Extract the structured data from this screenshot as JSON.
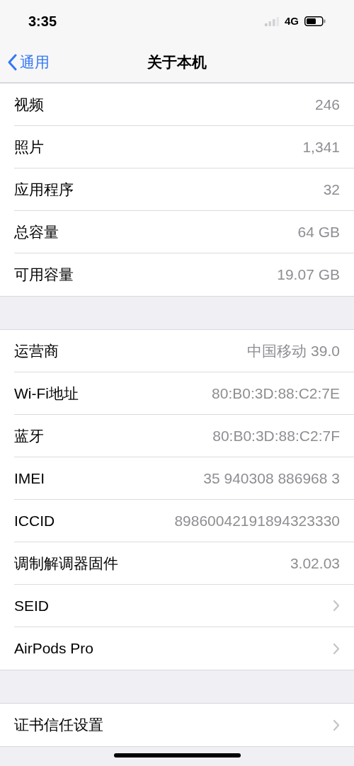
{
  "status_bar": {
    "time": "3:35",
    "network": "4G"
  },
  "nav": {
    "back": "通用",
    "title": "关于本机"
  },
  "groups": [
    {
      "rows": [
        {
          "kind": "value",
          "label": "视频",
          "value": "246"
        },
        {
          "kind": "value",
          "label": "照片",
          "value": "1,341"
        },
        {
          "kind": "value",
          "label": "应用程序",
          "value": "32"
        },
        {
          "kind": "value",
          "label": "总容量",
          "value": "64 GB"
        },
        {
          "kind": "value",
          "label": "可用容量",
          "value": "19.07 GB"
        }
      ]
    },
    {
      "rows": [
        {
          "kind": "value",
          "label": "运营商",
          "value": "中国移动 39.0"
        },
        {
          "kind": "value",
          "label": "Wi-Fi地址",
          "value": "80:B0:3D:88:C2:7E"
        },
        {
          "kind": "value",
          "label": "蓝牙",
          "value": "80:B0:3D:88:C2:7F"
        },
        {
          "kind": "value",
          "label": "IMEI",
          "value": "35 940308 886968 3"
        },
        {
          "kind": "value",
          "label": "ICCID",
          "value": "89860042191894323330"
        },
        {
          "kind": "value",
          "label": "调制解调器固件",
          "value": "3.02.03"
        },
        {
          "kind": "link",
          "label": "SEID"
        },
        {
          "kind": "link",
          "label": "AirPods Pro"
        }
      ]
    },
    {
      "rows": [
        {
          "kind": "link",
          "label": "证书信任设置"
        }
      ]
    }
  ]
}
